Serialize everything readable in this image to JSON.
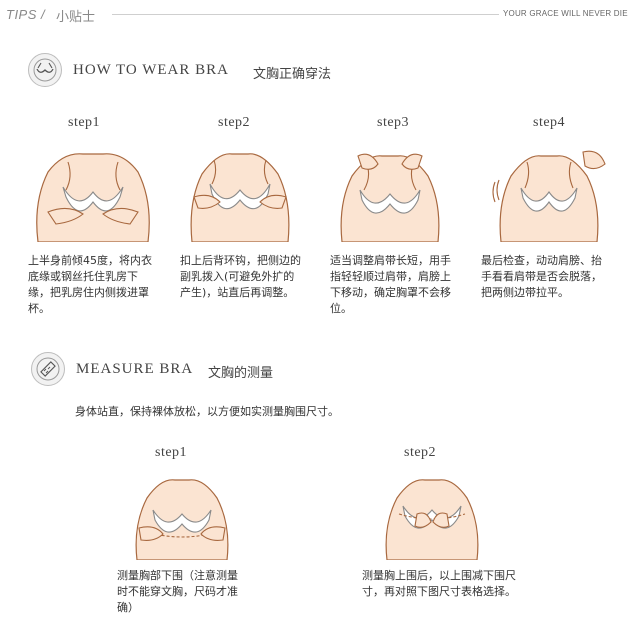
{
  "header": {
    "tips": "TIPS",
    "sep": "/",
    "title_cn": "小贴士",
    "slogan": "YOUR GRACE WILL NEVER DIE"
  },
  "wear": {
    "icon": "bra-icon",
    "title_en": "HOW TO WEAR BRA",
    "title_cn": "文胸正确穿法",
    "steps": [
      {
        "label": "step1",
        "desc": "上半身前倾45度，将内衣底缘或钢丝托住乳房下缘，把乳房住内侧拨进罩杯。"
      },
      {
        "label": "step2",
        "desc": "扣上后背环钩，把侧边的副乳拨入(可避免外扩的产生)，站直后再调整。"
      },
      {
        "label": "step3",
        "desc": "适当调整肩带长短，用手指轻轻顺过肩带，肩膀上下移动，确定胸罩不会移位。"
      },
      {
        "label": "step4",
        "desc": "最后检查，动动肩膀、抬手看看肩带是否会脱落，把两侧边带拉平。"
      }
    ]
  },
  "measure": {
    "icon": "ruler-icon",
    "title_en": "MEASURE BRA",
    "title_cn": "文胸的测量",
    "intro": "身体站直，保持裸体放松，以方便如实测量胸围尺寸。",
    "steps": [
      {
        "label": "step1",
        "desc": "测量胸部下围（注意测量时不能穿文胸，尺码才准确）"
      },
      {
        "label": "step2",
        "desc": "测量胸上围后，以上围减下围尺寸，再对照下图尺寸表格选择。"
      }
    ]
  }
}
